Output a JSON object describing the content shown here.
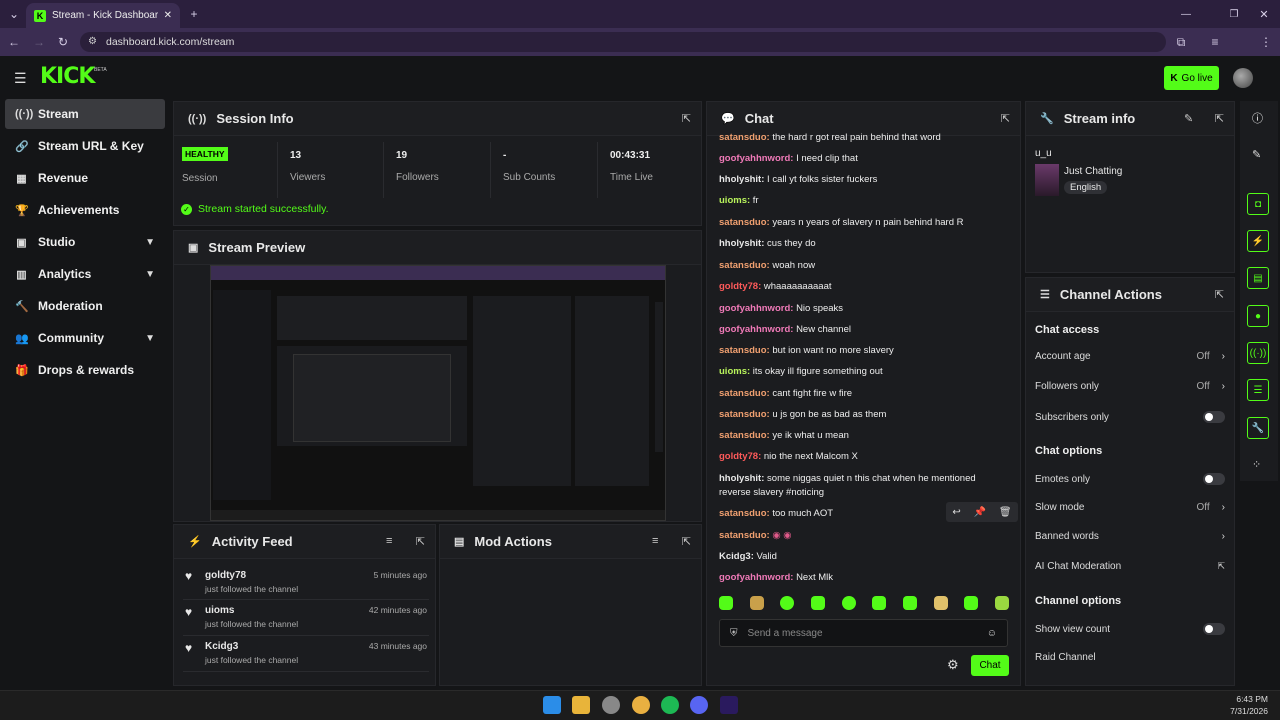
{
  "browser": {
    "tab_title": "Stream - Kick Dashboard",
    "url": "dashboard.kick.com/stream"
  },
  "header": {
    "logo": "KICK",
    "beta": "BETA",
    "go_live": "Go live"
  },
  "sidebar": {
    "items": [
      {
        "label": "Stream",
        "icon": "broadcast-icon"
      },
      {
        "label": "Stream URL & Key",
        "icon": "link-icon"
      },
      {
        "label": "Revenue",
        "icon": "chart-icon"
      },
      {
        "label": "Achievements",
        "icon": "trophy-icon"
      },
      {
        "label": "Studio",
        "icon": "studio-icon"
      },
      {
        "label": "Analytics",
        "icon": "analytics-icon"
      },
      {
        "label": "Moderation",
        "icon": "hammer-icon"
      },
      {
        "label": "Community",
        "icon": "people-icon"
      },
      {
        "label": "Drops & rewards",
        "icon": "gift-icon"
      }
    ]
  },
  "session": {
    "title": "Session Info",
    "health": "HEALTHY",
    "session_label": "Session",
    "stats": [
      {
        "value": "13",
        "label": "Viewers"
      },
      {
        "value": "19",
        "label": "Followers"
      },
      {
        "value": "-",
        "label": "Sub Counts"
      },
      {
        "value": "00:43:31",
        "label": "Time Live"
      }
    ],
    "status": "Stream started successfully."
  },
  "preview": {
    "title": "Stream Preview"
  },
  "activity": {
    "title": "Activity Feed",
    "items": [
      {
        "name": "goldty78",
        "action": "just followed the channel",
        "time": "5 minutes ago"
      },
      {
        "name": "uioms",
        "action": "just followed the channel",
        "time": "42 minutes ago"
      },
      {
        "name": "Kcidg3",
        "action": "just followed the channel",
        "time": "43 minutes ago"
      }
    ]
  },
  "mod_actions": {
    "title": "Mod Actions"
  },
  "chat": {
    "title": "Chat",
    "messages": [
      {
        "user": "satansduo",
        "text": "the hard r got real pain behind that word",
        "color": "#f0a070"
      },
      {
        "user": "goofyahhnword",
        "text": "I need clip that",
        "color": "#f07ab8"
      },
      {
        "user": "hholyshit",
        "text": "I call yt folks sister fuckers",
        "color": "#e8e8e8"
      },
      {
        "user": "uioms",
        "text": "fr",
        "color": "#b9f45c"
      },
      {
        "user": "satansduo",
        "text": "years n years of slavery n pain behind hard R",
        "color": "#f0a070"
      },
      {
        "user": "hholyshit",
        "text": "cus they do",
        "color": "#e8e8e8"
      },
      {
        "user": "satansduo",
        "text": "woah now",
        "color": "#f0a070"
      },
      {
        "user": "goldty78",
        "text": "whaaaaaaaaaat",
        "color": "#ff5a5a"
      },
      {
        "user": "goofyahhnword",
        "text": "Nio speaks",
        "color": "#f07ab8"
      },
      {
        "user": "goofyahhnword",
        "text": "New channel",
        "color": "#f07ab8"
      },
      {
        "user": "satansduo",
        "text": "but ion want no more slavery",
        "color": "#f0a070"
      },
      {
        "user": "uioms",
        "text": "its okay ill figure something out",
        "color": "#b9f45c"
      },
      {
        "user": "satansduo",
        "text": "cant fight fire w fire",
        "color": "#f0a070"
      },
      {
        "user": "satansduo",
        "text": "u js gon be as bad as them",
        "color": "#f0a070"
      },
      {
        "user": "satansduo",
        "text": "ye ik what u mean",
        "color": "#f0a070"
      },
      {
        "user": "goldty78",
        "text": "nio the next Malcom X",
        "color": "#ff5a5a"
      },
      {
        "user": "hholyshit",
        "text": "some niggas quiet n this chat when he mentioned reverse slavery #noticing",
        "color": "#e8e8e8"
      },
      {
        "user": "satansduo",
        "text": "too much AOT",
        "color": "#f0a070"
      },
      {
        "user": "satansduo",
        "text": "",
        "color": "#f0a070"
      },
      {
        "user": "Kcidg3",
        "text": "Valid",
        "color": "#e8e8e8"
      },
      {
        "user": "goofyahhnword",
        "text": "Next Mlk",
        "color": "#f07ab8"
      }
    ],
    "input_placeholder": "Send a message",
    "send_label": "Chat"
  },
  "stream_info": {
    "title": "Stream info",
    "stream_title": "u_u",
    "category": "Just Chatting",
    "language": "English"
  },
  "channel_actions": {
    "title": "Channel Actions",
    "chat_access": "Chat access",
    "account_age": "Account age",
    "account_age_value": "Off",
    "followers_only": "Followers only",
    "followers_only_value": "Off",
    "subscribers_only": "Subscribers only",
    "chat_options": "Chat options",
    "emotes_only": "Emotes only",
    "slow_mode": "Slow mode",
    "slow_mode_value": "Off",
    "banned_words": "Banned words",
    "ai_moderation": "AI Chat Moderation",
    "channel_options": "Channel options",
    "show_view_count": "Show view count",
    "raid_channel": "Raid Channel"
  },
  "taskbar": {
    "time": "6:43 PM",
    "date": "7/31/2026"
  },
  "colors": {
    "accent": "#53fc18",
    "bg": "#141517",
    "panel": "#1b1c1f"
  }
}
